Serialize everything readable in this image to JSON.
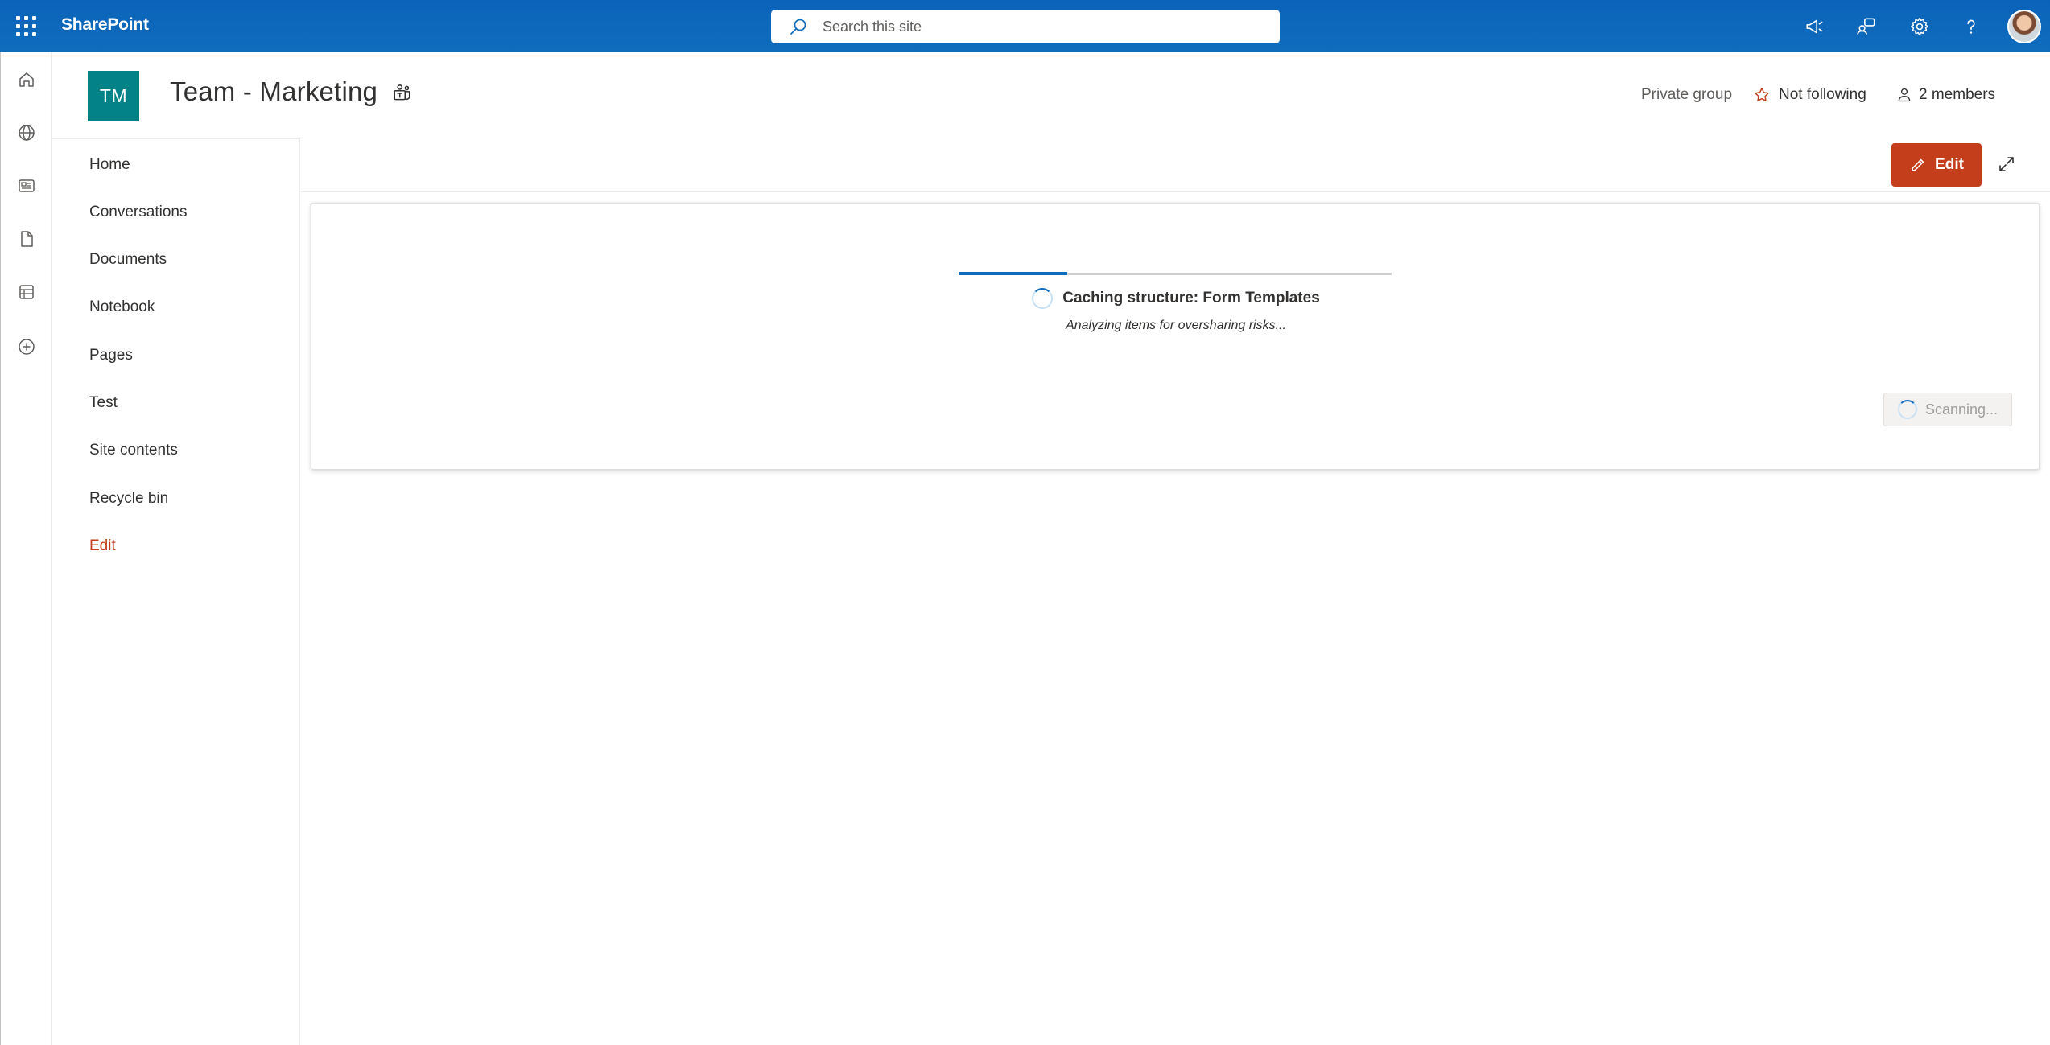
{
  "suite": {
    "brand": "SharePoint",
    "search_placeholder": "Search this site"
  },
  "appbar": {
    "items": [
      "home-icon",
      "globe-icon",
      "news-icon",
      "document-icon",
      "list-icon",
      "add-icon"
    ]
  },
  "site": {
    "logo_initials": "TM",
    "title": "Team - Marketing",
    "privacy": "Private group",
    "follow_label": "Not following",
    "members_label": "2 members"
  },
  "nav": {
    "items": [
      {
        "label": "Home"
      },
      {
        "label": "Conversations"
      },
      {
        "label": "Documents"
      },
      {
        "label": "Notebook"
      },
      {
        "label": "Pages"
      },
      {
        "label": "Test"
      },
      {
        "label": "Site contents"
      },
      {
        "label": "Recycle bin"
      }
    ],
    "edit_label": "Edit"
  },
  "commandbar": {
    "edit_label": "Edit"
  },
  "scan": {
    "progress_fraction": 0.25,
    "status": "Caching structure: Form Templates",
    "substatus": "Analyzing items for oversharing risks...",
    "button_label": "Scanning..."
  },
  "colors": {
    "suite_blue": "#0f6cbd",
    "site_logo": "#038387",
    "edit_accent": "#c43e1c"
  }
}
